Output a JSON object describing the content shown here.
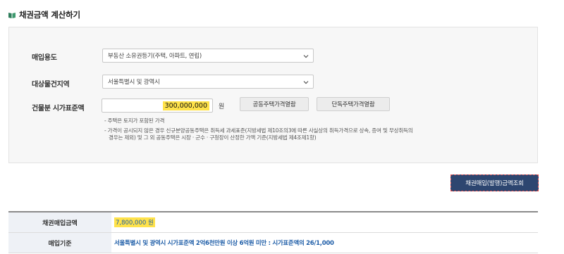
{
  "page": {
    "title": "채권금액 계산하기"
  },
  "form": {
    "purpose": {
      "label": "매입용도",
      "selected": "부동산 소유권등기(주택, 아파트, 연립)"
    },
    "region": {
      "label": "대상물건지역",
      "selected": "서울특별시 및 광역시"
    },
    "price": {
      "label": "건물분 시가표준액",
      "value": "300,000,000",
      "unit": "원",
      "btn_shared": "공동주택가격열람",
      "btn_single": "단독주택가격열람"
    },
    "notes": [
      "- 주택은 토지가 포함된 가격",
      "- 가격이 공시되지 않은 경우 신규분양공동주택은 취득세 과세표준(지방세법 제10조의3에 따른 사실상의 취득가격으로 상속, 증여 및 무상취득의",
      "경우는 제외) 및 그 외 공동주택은 시장 · 군수 · 구청장이 산정한 가액 기준(지방세법 제4조제1항)"
    ]
  },
  "actions": {
    "query": "채권매입(발행)금액조회"
  },
  "result": {
    "amount_label": "채권매입금액",
    "amount_value": "7,800,000 원",
    "basis_label": "매입기준",
    "basis_value": "서울특별시 및 광역시 시가표준액 2억6천만원 이상 6억원 미만 : 시가표준액의 26/1,000"
  },
  "colors": {
    "accent_button": "#2d4670",
    "highlight": "#ffe24a",
    "result_text": "#1f5ea8"
  }
}
